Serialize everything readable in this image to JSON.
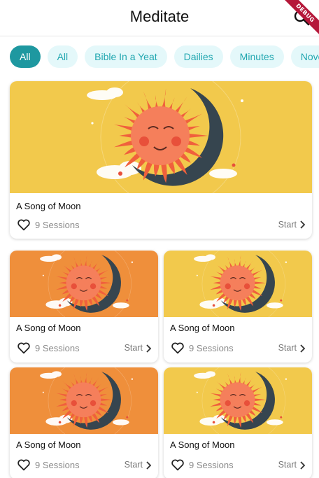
{
  "header": {
    "title": "Meditate",
    "search_icon": "search-icon",
    "debug_badge": "DEBUG"
  },
  "chips": [
    {
      "label": "All",
      "active": true
    },
    {
      "label": "All",
      "active": false
    },
    {
      "label": "Bible In a Yeat",
      "active": false
    },
    {
      "label": "Dailies",
      "active": false
    },
    {
      "label": "Minutes",
      "active": false
    },
    {
      "label": "Noven",
      "active": false
    }
  ],
  "colors": {
    "accent": "#1e98a0",
    "chip_bg": "#e4f8fa",
    "chip_text": "#21a7b0",
    "art_yellow": "#f2c94c",
    "art_orange": "#ef8f3b"
  },
  "featured": {
    "title": "A Song of Moon",
    "sessions": "9 Sessions",
    "start": "Start"
  },
  "cards": [
    {
      "title": "A Song of Moon",
      "sessions": "9 Sessions",
      "start": "Start",
      "art_bg": "orange"
    },
    {
      "title": "A Song of Moon",
      "sessions": "9 Sessions",
      "start": "Start",
      "art_bg": "yellow"
    },
    {
      "title": "A Song of Moon",
      "sessions": "9 Sessions",
      "start": "Start",
      "art_bg": "orange"
    },
    {
      "title": "A Song of Moon",
      "sessions": "9 Sessions",
      "start": "Start",
      "art_bg": "yellow"
    }
  ]
}
